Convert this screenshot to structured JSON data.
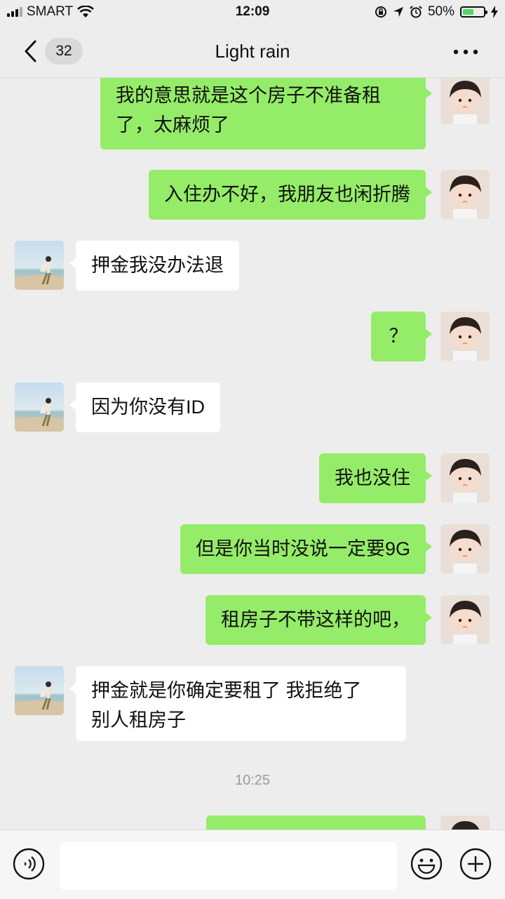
{
  "status_bar": {
    "carrier": "SMART",
    "time": "12:09",
    "battery_percent": "50%",
    "battery_level": 0.5
  },
  "nav": {
    "unread_count": "32",
    "title": "Light rain"
  },
  "messages": [
    {
      "side": "me",
      "text": "我的意思就是这个房子不准备租\n了，太麻烦了"
    },
    {
      "side": "me",
      "text": "入住办不好，我朋友也闲折腾"
    },
    {
      "side": "other",
      "text": "押金我没办法退"
    },
    {
      "side": "me",
      "text": "？"
    },
    {
      "side": "other",
      "text": "因为你没有ID"
    },
    {
      "side": "me",
      "text": "我也没住"
    },
    {
      "side": "me",
      "text": "但是你当时没说一定要9G"
    },
    {
      "side": "me",
      "text": "租房子不带这样的吧，"
    },
    {
      "side": "other",
      "text": "押金就是你确定要租了 我拒绝了\n别人租房子"
    }
  ],
  "timestamp": "10:25",
  "input": {
    "value": "",
    "placeholder": ""
  },
  "colors": {
    "my_bubble": "#95ec69",
    "their_bubble": "#ffffff",
    "background": "#ededed"
  }
}
